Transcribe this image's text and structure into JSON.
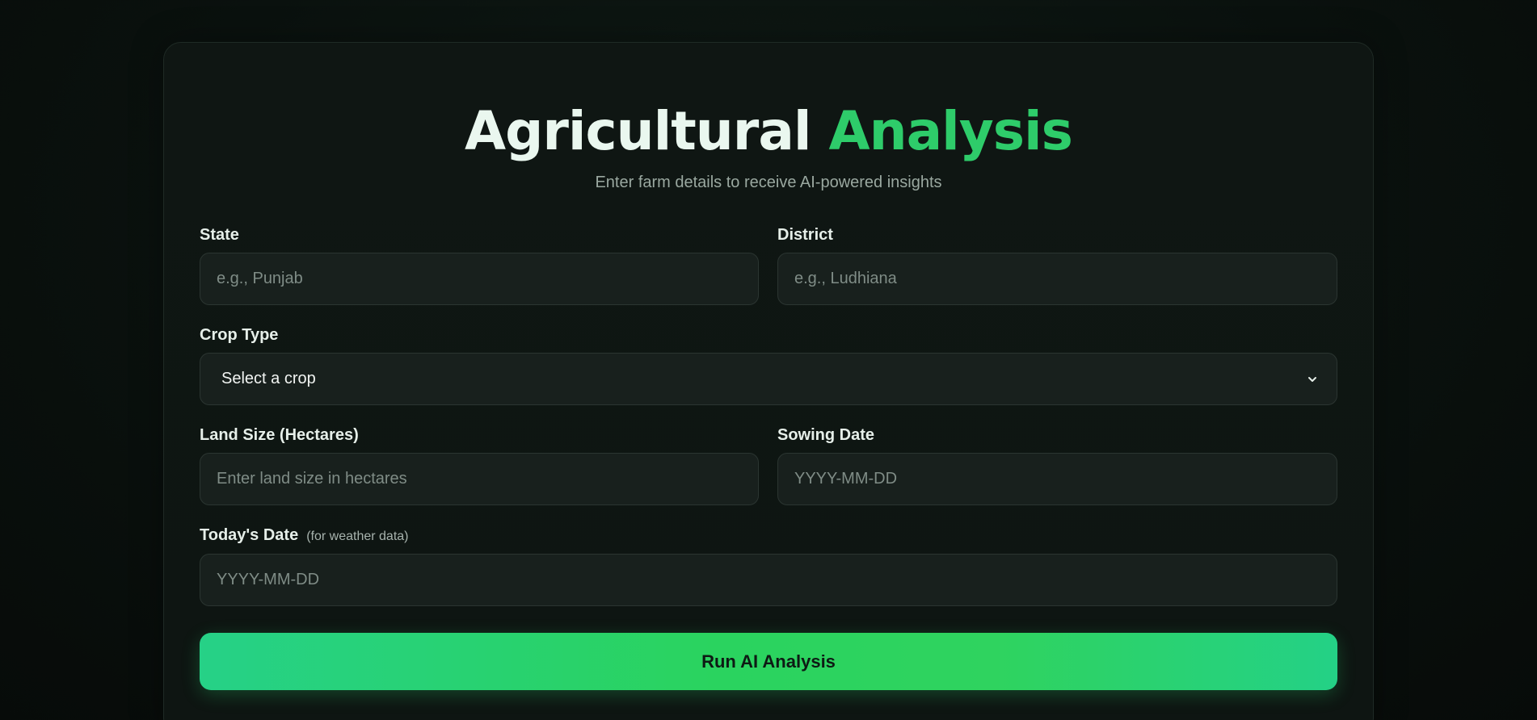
{
  "header": {
    "title_main": "Agricultural",
    "title_accent": "Analysis",
    "subtitle": "Enter farm details to receive AI-powered insights"
  },
  "form": {
    "state": {
      "label": "State",
      "placeholder": "e.g., Punjab",
      "value": ""
    },
    "district": {
      "label": "District",
      "placeholder": "e.g., Ludhiana",
      "value": ""
    },
    "crop_type": {
      "label": "Crop Type",
      "selected": "Select a crop"
    },
    "land_size": {
      "label": "Land Size (Hectares)",
      "placeholder": "Enter land size in hectares",
      "value": ""
    },
    "sowing_date": {
      "label": "Sowing Date",
      "placeholder": "YYYY-MM-DD",
      "value": ""
    },
    "todays_date": {
      "label": "Today's Date",
      "hint": "(for weather data)",
      "placeholder": "YYYY-MM-DD",
      "value": ""
    }
  },
  "actions": {
    "submit_label": "Run AI Analysis"
  },
  "icons": {
    "crop_select_chevron": "chevron-down-icon"
  },
  "colors": {
    "accent": "#2ecc6a",
    "background": "#0a110e",
    "field_background": "#18201d",
    "button_gradient_start": "#26d187",
    "button_gradient_mid": "#2ad35f"
  }
}
